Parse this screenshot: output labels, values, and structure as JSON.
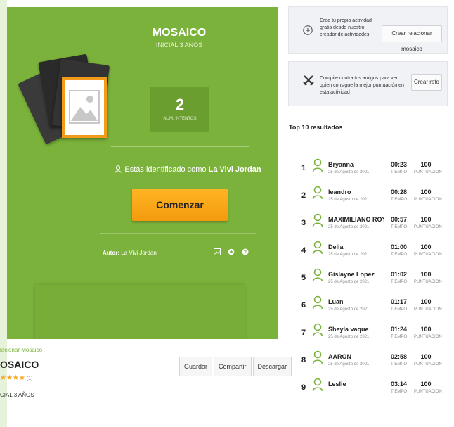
{
  "activity": {
    "title": "MOSAICO",
    "subtitle": "INICIAL 3 AÑOS",
    "attempts_value": "2",
    "attempts_label": "NUM. INTENTOS",
    "identified_prefix": "Estás identificado como",
    "identified_user": "La Vivi Jordan",
    "start_button": "Comenzar",
    "author_label": "Autor:",
    "author_name": "La Vivi Jordan"
  },
  "below": {
    "breadcrumb": "lacionar Mosaico",
    "title": "OSAICO",
    "stars": "★★★★",
    "rating_count": "(1)",
    "level": "CIAL 3 AÑOS",
    "actions": [
      "Guardar",
      "Compartir",
      "Descargar"
    ],
    "more": "..."
  },
  "promos": [
    {
      "text": "Crea tu propia actividad gratis desde nuestro creador de actividades",
      "button": "Crear relacionar mosaico",
      "icon": "plus-circle-icon"
    },
    {
      "text": "Compite contra tus amigos para ver quien consigue la mejor puntuación en esta actividad",
      "button": "Crear reto",
      "icon": "crossed-swords-icon"
    }
  ],
  "leaderboard": {
    "title": "Top 10 resultados",
    "time_label": "TIEMPO",
    "score_label": "PUNTUACION",
    "rows": [
      {
        "rank": "1",
        "name": "Bryanna",
        "date": "25 de Agosto de 2021",
        "time": "00:23",
        "score": "100"
      },
      {
        "rank": "2",
        "name": "leandro",
        "date": "25 de Agosto de 2021",
        "time": "00:28",
        "score": "100"
      },
      {
        "rank": "3",
        "name": "MAXIMILIANO ROY CO...",
        "date": "25 de Agosto de 2021",
        "time": "00:57",
        "score": "100"
      },
      {
        "rank": "4",
        "name": "Delia",
        "date": "25 de Agosto de 2021",
        "time": "01:00",
        "score": "100"
      },
      {
        "rank": "5",
        "name": "Gislayne Lopez",
        "date": "25 de Agosto de 2021",
        "time": "01:02",
        "score": "100"
      },
      {
        "rank": "6",
        "name": "Luan",
        "date": "25 de Agosto de 2021",
        "time": "01:17",
        "score": "100"
      },
      {
        "rank": "7",
        "name": "Sheyla vaque",
        "date": "25 de Agosto de 2021",
        "time": "01:24",
        "score": "100"
      },
      {
        "rank": "8",
        "name": "AARON",
        "date": "25 de Agosto de 2021",
        "time": "02:58",
        "score": "100"
      },
      {
        "rank": "9",
        "name": "Leslie",
        "date": "",
        "time": "03:14",
        "score": "100"
      }
    ]
  },
  "colors": {
    "card_green": "#7bb23b",
    "start_orange": "#f5a412",
    "avatar_green": "#7bb23b"
  }
}
